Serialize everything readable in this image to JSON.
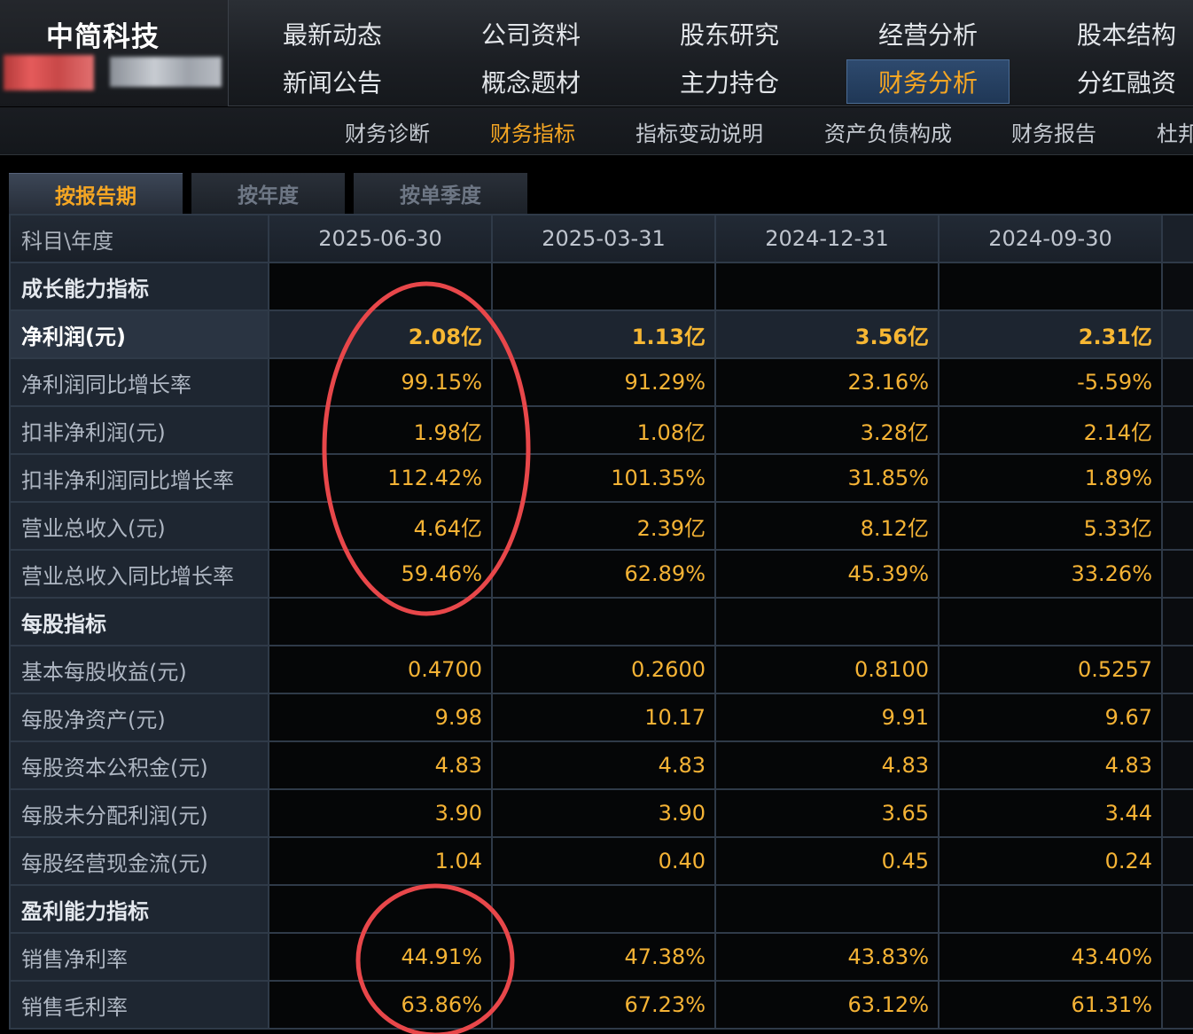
{
  "header": {
    "company_name": "中简科技",
    "nav_row1": [
      "最新动态",
      "公司资料",
      "股东研究",
      "经营分析",
      "股本结构"
    ],
    "nav_row2": [
      "新闻公告",
      "概念题材",
      "主力持仓",
      "财务分析",
      "分红融资"
    ],
    "active_nav": "财务分析"
  },
  "subnav": {
    "items": [
      "财务诊断",
      "财务指标",
      "指标变动说明",
      "资产负债构成",
      "财务报告",
      "杜邦"
    ],
    "active": "财务指标"
  },
  "period_tabs": {
    "items": [
      "按报告期",
      "按年度",
      "按单季度"
    ],
    "active": "按报告期"
  },
  "table": {
    "header_label": "科目\\年度",
    "dates": [
      "2025-06-30",
      "2025-03-31",
      "2024-12-31",
      "2024-09-30"
    ],
    "rows": [
      {
        "label": "成长能力指标",
        "type": "section",
        "values": [
          "",
          "",
          "",
          ""
        ]
      },
      {
        "label": "净利润(元)",
        "type": "highlight",
        "values": [
          "2.08亿",
          "1.13亿",
          "3.56亿",
          "2.31亿"
        ]
      },
      {
        "label": "净利润同比增长率",
        "type": "normal",
        "values": [
          "99.15%",
          "91.29%",
          "23.16%",
          "-5.59%"
        ]
      },
      {
        "label": "扣非净利润(元)",
        "type": "normal",
        "values": [
          "1.98亿",
          "1.08亿",
          "3.28亿",
          "2.14亿"
        ]
      },
      {
        "label": "扣非净利润同比增长率",
        "type": "normal",
        "values": [
          "112.42%",
          "101.35%",
          "31.85%",
          "1.89%"
        ]
      },
      {
        "label": "营业总收入(元)",
        "type": "normal",
        "values": [
          "4.64亿",
          "2.39亿",
          "8.12亿",
          "5.33亿"
        ]
      },
      {
        "label": "营业总收入同比增长率",
        "type": "normal",
        "values": [
          "59.46%",
          "62.89%",
          "45.39%",
          "33.26%"
        ]
      },
      {
        "label": "每股指标",
        "type": "section",
        "values": [
          "",
          "",
          "",
          ""
        ]
      },
      {
        "label": "基本每股收益(元)",
        "type": "normal",
        "values": [
          "0.4700",
          "0.2600",
          "0.8100",
          "0.5257"
        ]
      },
      {
        "label": "每股净资产(元)",
        "type": "normal",
        "values": [
          "9.98",
          "10.17",
          "9.91",
          "9.67"
        ]
      },
      {
        "label": "每股资本公积金(元)",
        "type": "normal",
        "values": [
          "4.83",
          "4.83",
          "4.83",
          "4.83"
        ]
      },
      {
        "label": "每股未分配利润(元)",
        "type": "normal",
        "values": [
          "3.90",
          "3.90",
          "3.65",
          "3.44"
        ]
      },
      {
        "label": "每股经营现金流(元)",
        "type": "normal",
        "values": [
          "1.04",
          "0.40",
          "0.45",
          "0.24"
        ]
      },
      {
        "label": "盈利能力指标",
        "type": "section",
        "values": [
          "",
          "",
          "",
          ""
        ]
      },
      {
        "label": "销售净利率",
        "type": "normal",
        "values": [
          "44.91%",
          "47.38%",
          "43.83%",
          "43.40%"
        ]
      },
      {
        "label": "销售毛利率",
        "type": "normal",
        "values": [
          "63.86%",
          "67.23%",
          "63.12%",
          "61.31%"
        ]
      }
    ]
  },
  "colors": {
    "accent": "#f5a623",
    "annotation": "#e8474a",
    "value_text": "#f5b335"
  }
}
